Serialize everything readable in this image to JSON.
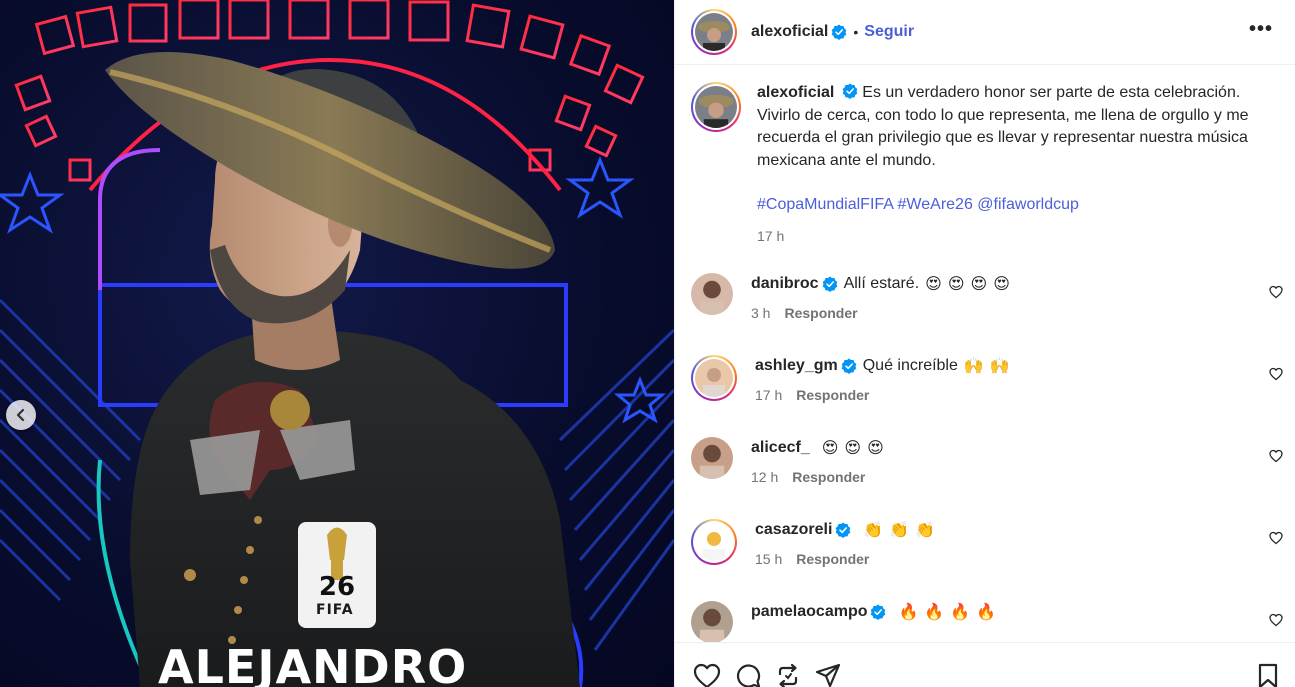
{
  "poster": {
    "name_text": "ALEJANDRO",
    "logo_text": "FIFA",
    "logo_number": "26"
  },
  "header": {
    "username": "alexoficial",
    "dot": "•",
    "follow_label": "Seguir",
    "more_label": "•••"
  },
  "caption": {
    "username": "alexoficial",
    "line1": "Es un verdadero honor ser parte de esta celebración.",
    "line2": "Vivirlo de cerca, con todo lo que representa, me llena de orgullo y me recuerda el gran privilegio que es llevar y representar nuestra música mexicana ante el mundo.",
    "hashtags": [
      "#CopaMundialFIFA",
      "#WeAre26",
      "@fifaworldcup"
    ],
    "time": "17 h"
  },
  "comments": [
    {
      "username": "danibroc",
      "verified": true,
      "text": "Allí estaré.",
      "emojis": [
        "😍",
        "😍",
        "😍",
        "😍"
      ],
      "time": "3 h",
      "reply": "Responder"
    },
    {
      "username": "ashley_gm",
      "verified": true,
      "text": "Qué increíble",
      "emojis": [
        "🙌",
        "🙌"
      ],
      "time": "17 h",
      "reply": "Responder"
    },
    {
      "username": "alicecf_",
      "verified": false,
      "text": "",
      "emojis": [
        "😍",
        "😍",
        "😍"
      ],
      "time": "12 h",
      "reply": "Responder"
    },
    {
      "username": "casazoreli",
      "verified": true,
      "text": "",
      "emojis": [
        "👏",
        "👏",
        "👏"
      ],
      "time": "15 h",
      "reply": "Responder"
    },
    {
      "username": "pamelaocampo",
      "verified": true,
      "text": "",
      "emojis": [
        "🔥",
        "🔥",
        "🔥",
        "🔥"
      ],
      "time": "",
      "reply": ""
    }
  ],
  "colors": {
    "link_blue": "#4a5fd8",
    "verified_blue": "#0095f6",
    "text_dark": "#262626",
    "text_muted": "#737373",
    "divider": "#efefef"
  },
  "icons": {
    "like": "heart-icon",
    "comment": "comment-icon",
    "repost": "repost-icon",
    "share": "share-icon",
    "save": "bookmark-icon",
    "prev": "chevron-left-icon"
  }
}
